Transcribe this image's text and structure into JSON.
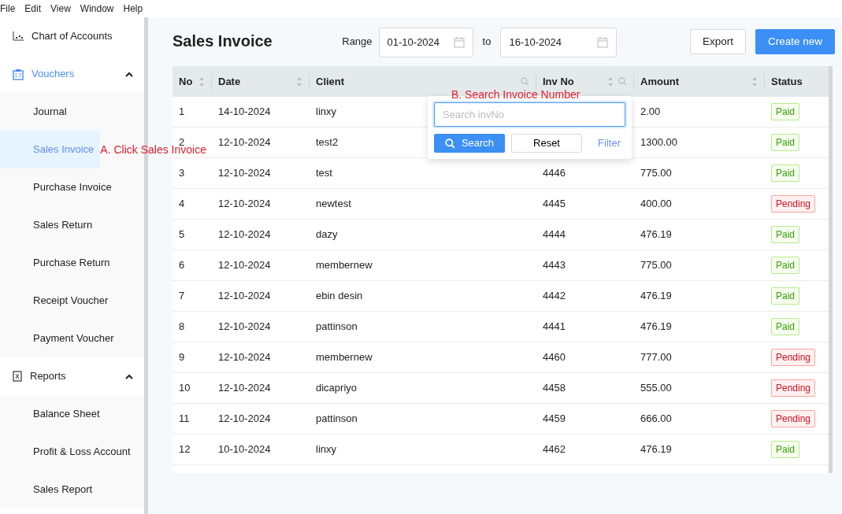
{
  "menu_bar": [
    "File",
    "Edit",
    "View",
    "Window",
    "Help"
  ],
  "sidebar": {
    "items": [
      {
        "label": "Chart of Accounts",
        "selected": false
      },
      {
        "label": "Vouchers",
        "selected": true,
        "expanded": true,
        "children": [
          {
            "label": "Journal",
            "selected": false
          },
          {
            "label": "Sales Invoice",
            "selected": true,
            "annotation": "A. Click Sales Invoice"
          },
          {
            "label": "Purchase Invoice",
            "selected": false
          },
          {
            "label": "Sales Return",
            "selected": false
          },
          {
            "label": "Purchase Return",
            "selected": false
          },
          {
            "label": "Receipt Voucher",
            "selected": false
          },
          {
            "label": "Payment Voucher",
            "selected": false
          }
        ]
      },
      {
        "label": "Reports",
        "selected": false,
        "expanded": true,
        "children": [
          {
            "label": "Balance Sheet",
            "selected": false
          },
          {
            "label": "Profit & Loss Account",
            "selected": false
          },
          {
            "label": "Sales Report",
            "selected": false
          }
        ]
      }
    ]
  },
  "header": {
    "title": "Sales Invoice",
    "range_label": "Range",
    "from": "01-10-2024",
    "to_label": "to",
    "to": "16-10-2024",
    "buttons": [
      {
        "label": "Export",
        "kind": "default"
      },
      {
        "label": "Create new",
        "kind": "primary"
      }
    ]
  },
  "table": {
    "columns": [
      {
        "label": "No",
        "sortable": true,
        "searchable": false
      },
      {
        "label": "Date",
        "sortable": true,
        "searchable": false
      },
      {
        "label": "Client",
        "sortable": false,
        "searchable": true
      },
      {
        "label": "Inv No",
        "sortable": true,
        "searchable": true
      },
      {
        "label": "Amount",
        "sortable": true,
        "searchable": false
      },
      {
        "label": "Status",
        "sortable": false,
        "searchable": false
      }
    ],
    "rows": [
      {
        "cells": [
          "1",
          "14-10-2024",
          "linxy",
          "",
          "2.00"
        ],
        "status": "Paid",
        "kind": "paid"
      },
      {
        "cells": [
          "2",
          "12-10-2024",
          "test2",
          "",
          "1300.00"
        ],
        "status": "Paid",
        "kind": "paid"
      },
      {
        "cells": [
          "3",
          "12-10-2024",
          "test",
          "4446",
          "775.00"
        ],
        "status": "Paid",
        "kind": "paid"
      },
      {
        "cells": [
          "4",
          "12-10-2024",
          "newtest",
          "4445",
          "400.00"
        ],
        "status": "Pending",
        "kind": "pending"
      },
      {
        "cells": [
          "5",
          "12-10-2024",
          "dazy",
          "4444",
          "476.19"
        ],
        "status": "Paid",
        "kind": "paid"
      },
      {
        "cells": [
          "6",
          "12-10-2024",
          "membernew",
          "4443",
          "775.00"
        ],
        "status": "Paid",
        "kind": "paid"
      },
      {
        "cells": [
          "7",
          "12-10-2024",
          "ebin desin",
          "4442",
          "476.19"
        ],
        "status": "Paid",
        "kind": "paid"
      },
      {
        "cells": [
          "8",
          "12-10-2024",
          "pattinson",
          "4441",
          "476.19"
        ],
        "status": "Paid",
        "kind": "paid"
      },
      {
        "cells": [
          "9",
          "12-10-2024",
          "membernew",
          "4460",
          "777.00"
        ],
        "status": "Pending",
        "kind": "pending"
      },
      {
        "cells": [
          "10",
          "12-10-2024",
          "dicapriyo",
          "4458",
          "555.00"
        ],
        "status": "Pending",
        "kind": "pending"
      },
      {
        "cells": [
          "11",
          "12-10-2024",
          "pattinson",
          "4459",
          "666.00"
        ],
        "status": "Pending",
        "kind": "pending"
      },
      {
        "cells": [
          "12",
          "10-10-2024",
          "linxy",
          "4462",
          "476.19"
        ],
        "status": "Paid",
        "kind": "paid"
      }
    ]
  },
  "search_popup": {
    "annotation": "B. Search Invoice Number",
    "placeholder": "Search invNo",
    "search_button": "Search",
    "reset_button": "Reset",
    "filter_link": "Filter"
  }
}
